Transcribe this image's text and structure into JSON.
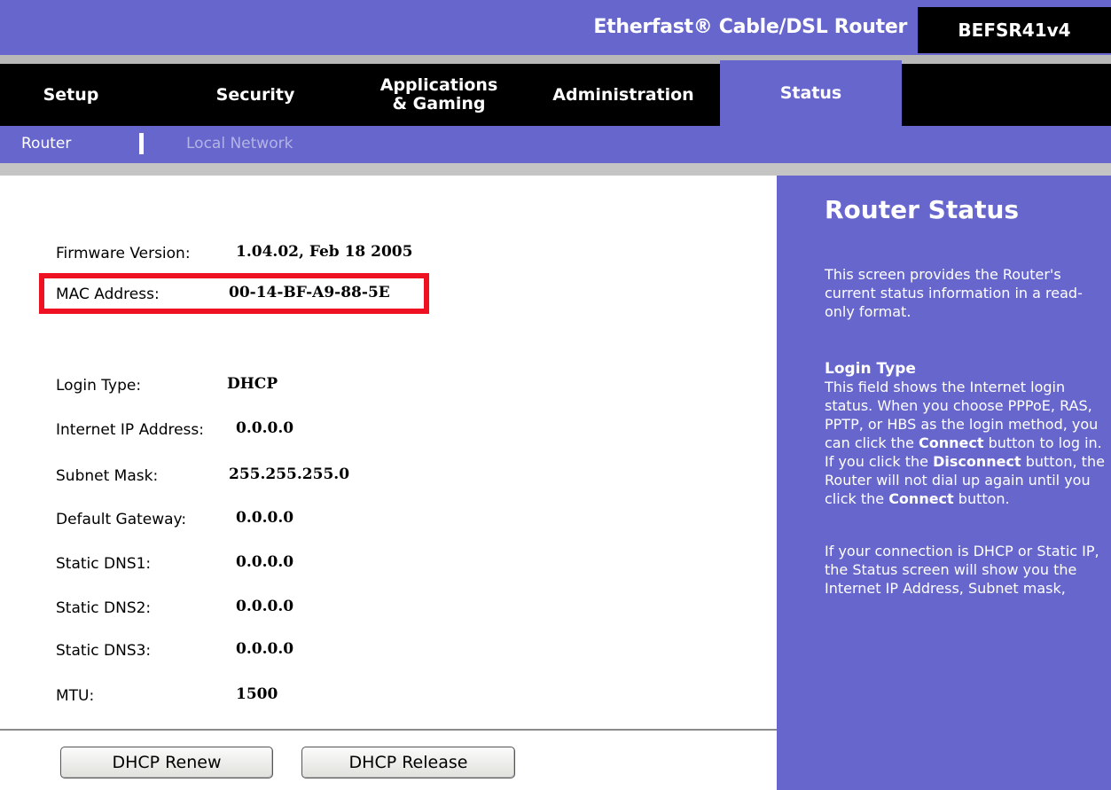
{
  "header": {
    "product_title": "Etherfast® Cable/DSL Router",
    "model": "BEFSR41v4"
  },
  "nav": {
    "tabs": [
      {
        "label": "Setup"
      },
      {
        "label": "Security"
      },
      {
        "label": "Applications\n& Gaming"
      },
      {
        "label": "Administration"
      },
      {
        "label": "Status",
        "active": true
      }
    ]
  },
  "subnav": {
    "items": [
      {
        "label": "Router",
        "active": true
      },
      {
        "label": "Local Network",
        "active": false
      }
    ]
  },
  "status": {
    "firmware": {
      "label": "Firmware Version:",
      "value": "1.04.02, Feb 18 2005"
    },
    "mac": {
      "label": "MAC Address:",
      "value": "00-14-BF-A9-88-5E"
    },
    "login_type": {
      "label": "Login Type:",
      "value": "DHCP"
    },
    "internet_ip": {
      "label": "Internet IP Address:",
      "value": "0.0.0.0"
    },
    "subnet_mask": {
      "label": "Subnet Mask:",
      "value": "255.255.255.0"
    },
    "default_gateway": {
      "label": "Default Gateway:",
      "value": "0.0.0.0"
    },
    "dns1": {
      "label": "Static DNS1:",
      "value": "0.0.0.0"
    },
    "dns2": {
      "label": "Static DNS2:",
      "value": "0.0.0.0"
    },
    "dns3": {
      "label": "Static DNS3:",
      "value": "0.0.0.0"
    },
    "mtu": {
      "label": "MTU:",
      "value": "1500"
    }
  },
  "buttons": {
    "renew": "DHCP Renew",
    "release": "DHCP Release"
  },
  "help": {
    "title": "Router Status",
    "intro": "This screen provides the Router's current status information in a read-only format.",
    "login_type_heading": "Login Type",
    "login_type_p1": "This field shows the Internet login status. When you choose PPPoE, RAS, PPTP, or HBS as the login method, you can click the",
    "connect": "Connect",
    "login_type_p2": "button to log in. If you click the",
    "disconnect": "Disconnect",
    "login_type_p3": "button, the Router will not dial up again until you click the",
    "login_type_p4": "button.",
    "dhcp_text": "If your connection is DHCP or Static IP, the Status screen will show you the Internet IP Address, Subnet mask,"
  },
  "colors": {
    "brand_purple": "#6666cc",
    "nav_black": "#000000",
    "highlight_red": "#ee1122",
    "inactive_subnav": "#b4b4e6"
  }
}
